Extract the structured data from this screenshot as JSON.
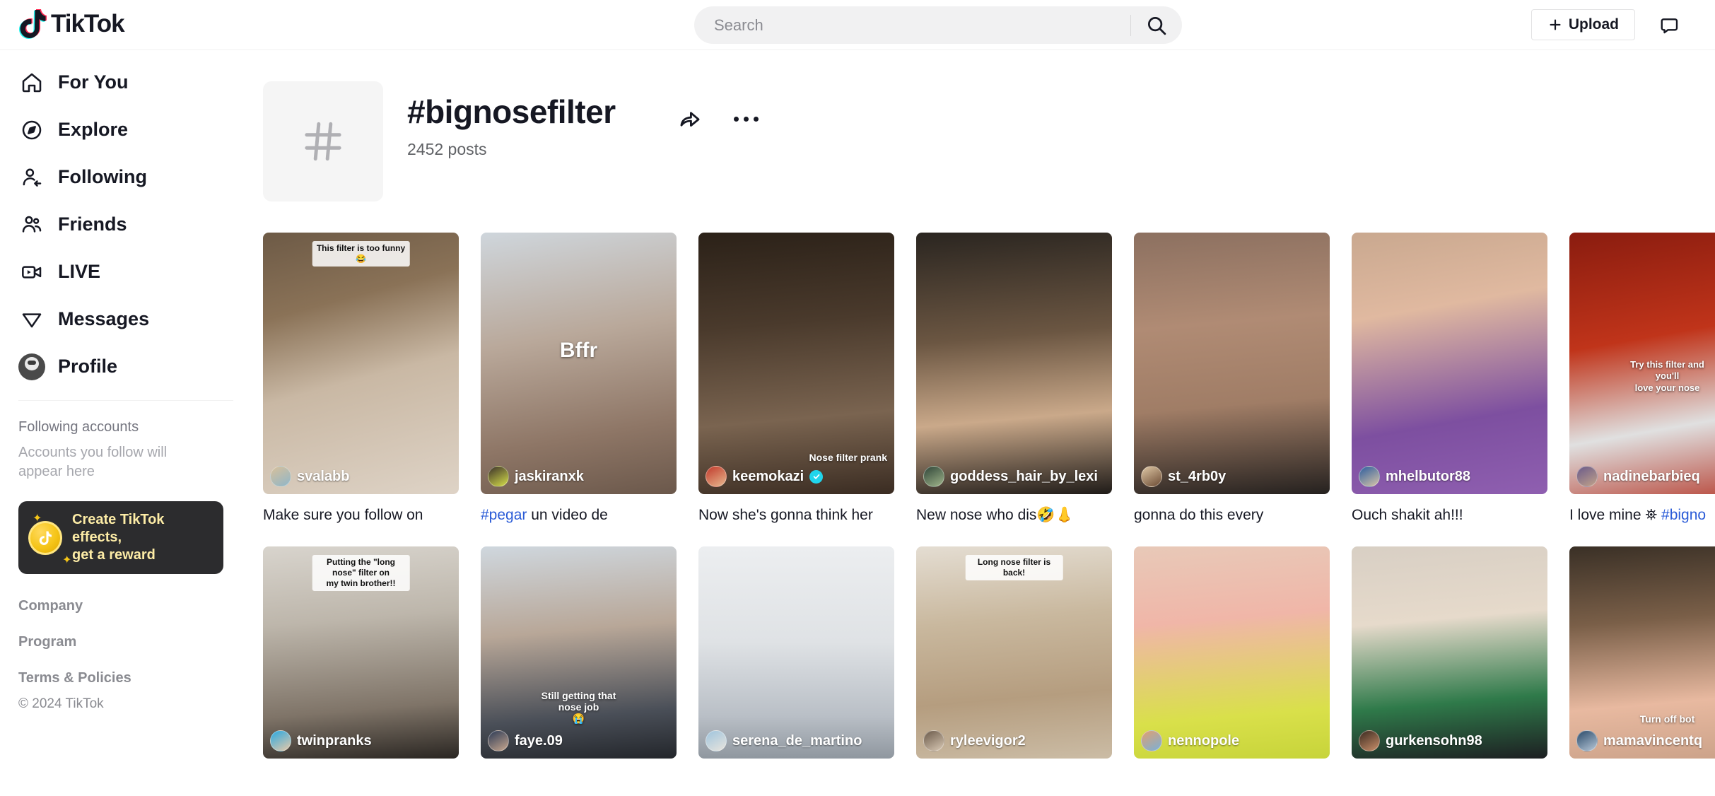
{
  "brand": {
    "name": "TikTok"
  },
  "search": {
    "placeholder": "Search",
    "value": "",
    "icon": "search-icon"
  },
  "header": {
    "upload_label": "Upload",
    "upload_icon": "plus-icon",
    "messages_icon": "message-icon"
  },
  "sidebar": {
    "items": [
      {
        "label": "For You",
        "icon": "home-icon"
      },
      {
        "label": "Explore",
        "icon": "compass-icon"
      },
      {
        "label": "Following",
        "icon": "user-follow-icon"
      },
      {
        "label": "Friends",
        "icon": "users-icon"
      },
      {
        "label": "LIVE",
        "icon": "live-video-icon"
      },
      {
        "label": "Messages",
        "icon": "send-icon"
      },
      {
        "label": "Profile",
        "icon": "avatar-icon"
      }
    ],
    "following_heading": "Following accounts",
    "following_sub": "Accounts you follow will appear here",
    "promo": {
      "line1": "Create TikTok effects,",
      "line2": "get a reward",
      "icon": "tiktok-coin-icon"
    },
    "footer": [
      {
        "label": "Company"
      },
      {
        "label": "Program"
      },
      {
        "label": "Terms & Policies"
      }
    ],
    "copyright": "© 2024 TikTok"
  },
  "hashtag": {
    "thumb_icon": "hash-icon",
    "title": "#bignosefilter",
    "posts": "2452 posts",
    "share_icon": "share-arrow-icon",
    "more_icon": "more-dots-icon"
  },
  "videos": [
    {
      "username": "svalabb",
      "caption": "Make sure you follow on",
      "caption_tag": "",
      "verified": false,
      "overlay": "This filter is too funny 😂",
      "overlay_style": "badge-top",
      "bg": "linear-gradient(165deg,#6d5a46 0%,#8a7257 28%,#c9b8a4 55%,#ded3c6 100%)",
      "av": "linear-gradient(150deg,#d8c09a,#8fb6c9)"
    },
    {
      "username": "jaskiranxk",
      "caption": "un video de",
      "caption_tag": "#pegar",
      "verified": false,
      "overlay": "Bffr",
      "overlay_style": "plain-mid",
      "bg": "linear-gradient(170deg,#cfd6dc 0%,#b9a89a 40%,#8e7666 75%,#6b584b 100%)",
      "av": "linear-gradient(150deg,#3a2f2a,#d8e14a)"
    },
    {
      "username": "keemokazi",
      "caption": "Now she's gonna think her",
      "caption_tag": "",
      "verified": true,
      "overlay": "Nose filter prank",
      "overlay_style": "plain-br",
      "bg": "linear-gradient(175deg,#2b2118 0%,#4a3a2c 35%,#7a6450 70%,#3a2c22 100%)",
      "av": "linear-gradient(150deg,#c0392b,#e8b98f)"
    },
    {
      "username": "goddess_hair_by_lexi",
      "caption": "New nose who dis🤣👃",
      "caption_tag": "",
      "verified": false,
      "overlay": "",
      "overlay_style": "",
      "bg": "linear-gradient(175deg,#2a2520 0%,#6b5642 40%,#caa98a 70%,#1f1b18 100%)",
      "av": "linear-gradient(150deg,#2f4438,#9fb58a)"
    },
    {
      "username": "st_4rb0y",
      "caption": "gonna do this every",
      "caption_tag": "",
      "verified": false,
      "overlay": "",
      "overlay_style": "",
      "bg": "linear-gradient(175deg,#8c7060 0%,#b08b74 35%,#a07d66 65%,#25211f 100%)",
      "av": "linear-gradient(150deg,#e0c9a6,#6b4a33)"
    },
    {
      "username": "mhelbutor88",
      "caption": "Ouch shakit ah!!!",
      "caption_tag": "",
      "verified": false,
      "overlay": "",
      "overlay_style": "",
      "bg": "linear-gradient(170deg,#c9a88f 0%,#e0b9a0 30%,#7d4fa0 70%,#8f5fb0 100%)",
      "av": "linear-gradient(150deg,#2c5c9e,#d9c6a8)"
    },
    {
      "username": "nadinebarbieq",
      "caption": "I love mine ⛯",
      "caption_tag": "#bigno",
      "verified": false,
      "overlay": "Try this filter and you'll\nlove your nose",
      "overlay_style": "badge-mid",
      "bg": "linear-gradient(170deg,#8a1c0f 0%,#c0341a 40%,#e0e0e0 72%,#b8473a 100%)",
      "av": "linear-gradient(150deg,#6a5a8a,#c2a38a)"
    }
  ],
  "videos_row2": [
    {
      "username": "twinpranks",
      "verified": false,
      "overlay": "Putting the \"long nose\" filter on\nmy twin brother!!",
      "overlay_style": "badge-top",
      "bg": "linear-gradient(175deg,#d8d4cd 0%,#bdb6ab 35%,#7f7468 75%,#2a2622 100%)",
      "av": "linear-gradient(150deg,#2aa8e0,#e8c9a8)"
    },
    {
      "username": "faye.09",
      "verified": false,
      "overlay": "Still getting that nose job\n😭",
      "overlay_style": "plain-low",
      "bg": "linear-gradient(175deg,#cfd7de 0%,#b8a798 40%,#4a4f58 78%,#23262b 100%)",
      "av": "linear-gradient(150deg,#2b3a55,#c9a88f)"
    },
    {
      "username": "serena_de_martino",
      "verified": false,
      "overlay": "",
      "overlay_style": "",
      "bg": "linear-gradient(180deg,#eceef0 0%,#dfe2e5 45%,#b9bfc6 80%,#8f979f 100%)",
      "av": "linear-gradient(150deg,#9fc4dd,#e8e4dd)"
    },
    {
      "username": "ryleevigor2",
      "verified": false,
      "overlay": "Long nose filter is back!",
      "overlay_style": "badge-top",
      "bg": "linear-gradient(175deg,#e4ddd2 0%,#c9b89e 35%,#b59d7f 70%,#cbbca5 100%)",
      "av": "linear-gradient(150deg,#6b5a4a,#d9c9b5)"
    },
    {
      "username": "nennopole",
      "verified": false,
      "overlay": "",
      "overlay_style": "",
      "bg": "linear-gradient(175deg,#e8c9b8 0%,#f0b6a8 35%,#d9e04a 78%,#c7d43a 100%)",
      "av": "linear-gradient(150deg,#e0a070,#7ab0d8)"
    },
    {
      "username": "gurkensohn98",
      "verified": false,
      "overlay": "",
      "overlay_style": "",
      "bg": "linear-gradient(175deg,#d8cfc4 0%,#e6dacb 35%,#2f7a4a 72%,#1d1f22 100%)",
      "av": "linear-gradient(150deg,#3a2a20,#c98f6a)"
    },
    {
      "username": "mamavincentq",
      "verified": false,
      "overlay": "Turn off bot",
      "overlay_style": "plain-low",
      "bg": "linear-gradient(175deg,#3a3026 0%,#7a5f48 35%,#e8b9a0 72%,#caa188 100%)",
      "av": "linear-gradient(150deg,#2a4a6a,#b8c8d8)"
    }
  ]
}
